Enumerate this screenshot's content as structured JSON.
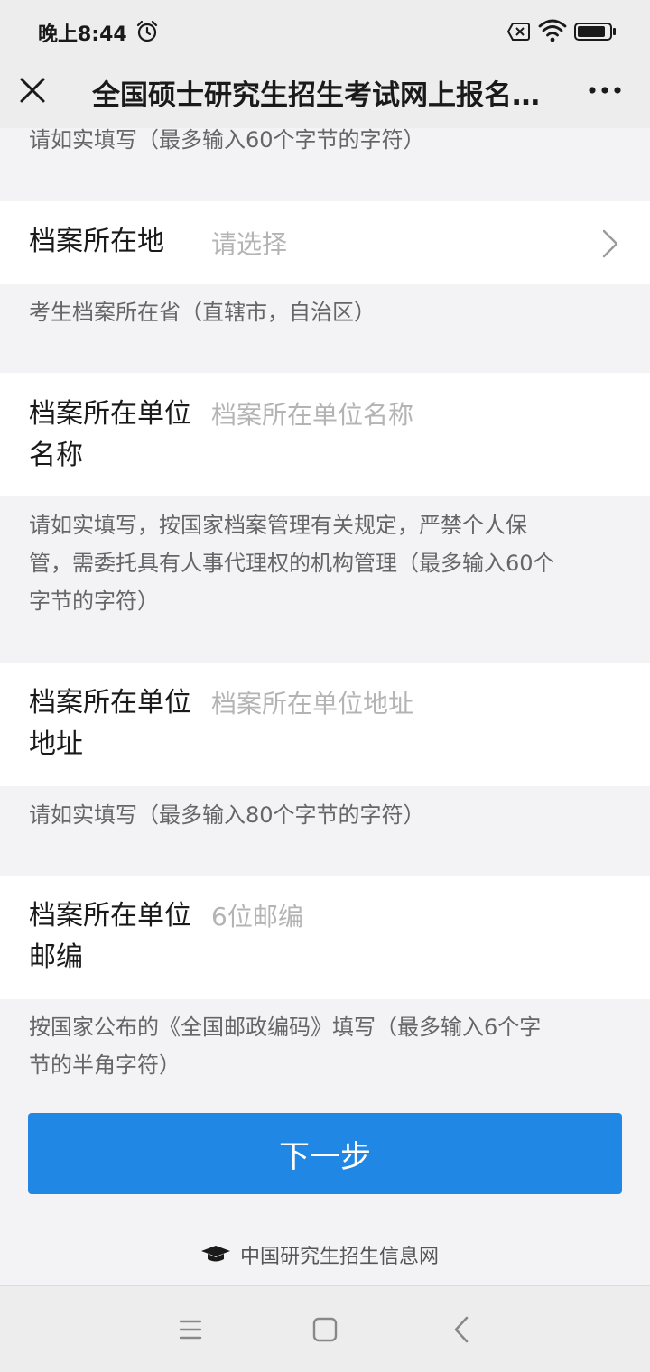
{
  "status_bar": {
    "time": "晚上8:44"
  },
  "nav": {
    "title": "全国硕士研究生招生考试网上报名..."
  },
  "form": {
    "hint_top": "请如实填写（最多输入60个字节的字符）",
    "archive_location": {
      "label": "档案所在地",
      "placeholder": "请选择",
      "hint": "考生档案所在省（直辖市，自治区）"
    },
    "archive_unit_name": {
      "label_line1": "档案所在单位",
      "label_line2": "名称",
      "placeholder": "档案所在单位名称",
      "hint_line1": "请如实填写，按国家档案管理有关规定，严禁个人保",
      "hint_line2": "管，需委托具有人事代理权的机构管理（最多输入60个",
      "hint_line3": "字节的字符）"
    },
    "archive_unit_address": {
      "label_line1": "档案所在单位",
      "label_line2": "地址",
      "placeholder": "档案所在单位地址",
      "hint": "请如实填写（最多输入80个字节的字符）"
    },
    "archive_unit_postcode": {
      "label_line1": "档案所在单位",
      "label_line2": "邮编",
      "placeholder": "6位邮编",
      "hint_line1": "按国家公布的《全国邮政编码》填写（最多输入6个字",
      "hint_line2": "节的半角字符）"
    }
  },
  "next_button": {
    "label": "下一步"
  },
  "footer": {
    "text": "中国研究生招生信息网"
  },
  "colors": {
    "accent": "#2088e4",
    "page_bg": "#f3f3f5",
    "bar_bg": "#ededed"
  }
}
